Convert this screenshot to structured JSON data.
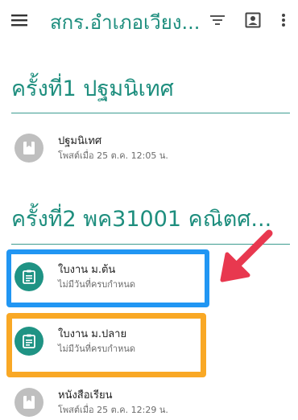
{
  "app_bar": {
    "title": "สกร.อำเภอเวียง...",
    "menu_icon": "menu-icon",
    "filter_icon": "filter-icon",
    "profile_icon": "account-box-icon",
    "more_icon": "more-vert-icon"
  },
  "topics": [
    {
      "title": "ครั้งที่1 ปฐมนิเทศ",
      "items": [
        {
          "title": "ปฐมนิเทศ",
          "subtitle": "โพสต์เมื่อ 25 ต.ค. 12:05 น.",
          "icon": "material-icon"
        }
      ]
    },
    {
      "title": "ครั้งที่2 พค31001 คณิตศ...",
      "items": [
        {
          "title": "ใบงาน ม.ต้น",
          "subtitle": "ไม่มีวันที่ครบกำหนด",
          "icon": "assignment-icon"
        },
        {
          "title": "ใบงาน ม.ปลาย",
          "subtitle": "ไม่มีวันที่ครบกำหนด",
          "icon": "assignment-icon"
        },
        {
          "title": "หนังสือเรียน",
          "subtitle": "โพสต์เมื่อ 25 ต.ค. 12:29 น.",
          "icon": "material-icon"
        }
      ]
    }
  ],
  "annotations": {
    "highlight_colors": {
      "blue": "#2196f3",
      "orange": "#f9a825"
    },
    "arrow_color": "#e8384f"
  },
  "colors": {
    "accent": "#1e8e7e",
    "divider": "#3d9c90"
  }
}
